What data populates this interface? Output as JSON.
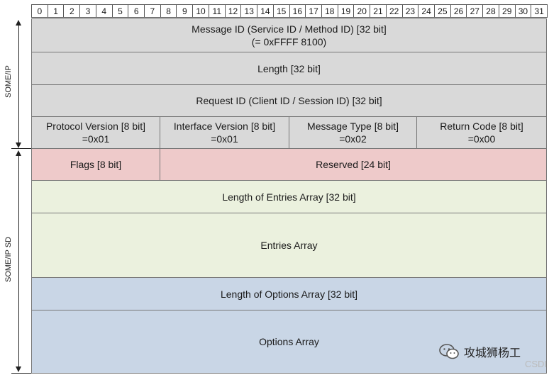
{
  "bits": [
    "0",
    "1",
    "2",
    "3",
    "4",
    "5",
    "6",
    "7",
    "8",
    "9",
    "10",
    "11",
    "12",
    "13",
    "14",
    "15",
    "16",
    "17",
    "18",
    "19",
    "20",
    "21",
    "22",
    "23",
    "24",
    "25",
    "26",
    "27",
    "28",
    "29",
    "30",
    "31"
  ],
  "side_labels": {
    "someip": "SOME/IP",
    "someip_sd": "SOME/IP SD"
  },
  "rows": {
    "message_id": {
      "line1": "Message ID (Service ID / Method ID) [32 bit]",
      "line2": "(= 0xFFFF 8100)"
    },
    "length": "Length [32 bit]",
    "request_id": "Request ID (Client ID / Session ID) [32 bit]",
    "protocol_version": {
      "line1": "Protocol Version [8 bit]",
      "line2": "=0x01"
    },
    "interface_version": {
      "line1": "Interface Version [8 bit]",
      "line2": "=0x01"
    },
    "message_type": {
      "line1": "Message Type [8 bit]",
      "line2": "=0x02"
    },
    "return_code": {
      "line1": "Return Code [8 bit]",
      "line2": "=0x00"
    },
    "flags": "Flags [8 bit]",
    "reserved": "Reserved [24 bit]",
    "length_entries": "Length of Entries Array [32 bit]",
    "entries_array": "Entries Array",
    "length_options": "Length of Options Array [32 bit]",
    "options_array": "Options Array"
  },
  "colors": {
    "header": "#d9d9d9",
    "flags": "#eecaca",
    "entries": "#ebf1de",
    "options": "#c9d6e6"
  },
  "watermark": {
    "text": "攻城狮杨工",
    "sub": "CSDI"
  }
}
